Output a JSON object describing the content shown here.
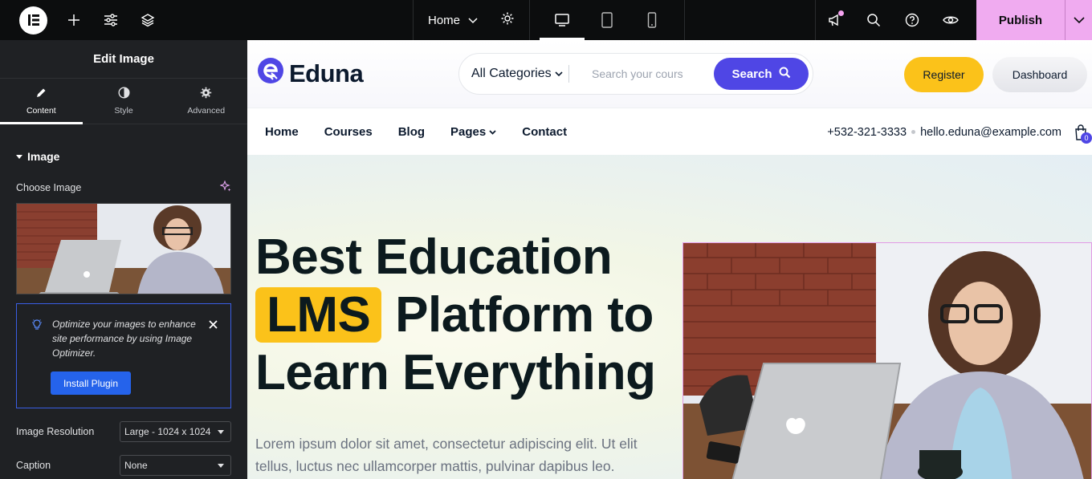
{
  "topbar": {
    "page_name": "Home",
    "publish_label": "Publish"
  },
  "panel": {
    "title": "Edit Image",
    "tabs": [
      {
        "label": "Content",
        "icon": "pencil-icon"
      },
      {
        "label": "Style",
        "icon": "half-circle-icon"
      },
      {
        "label": "Advanced",
        "icon": "gear-icon"
      }
    ],
    "section_title": "Image",
    "choose_image_label": "Choose Image",
    "notice_text": "Optimize your images to enhance site performance by using Image Optimizer.",
    "install_label": "Install Plugin",
    "resolution_label": "Image Resolution",
    "resolution_value": "Large - 1024 x 1024",
    "caption_label": "Caption",
    "caption_value": "None"
  },
  "site": {
    "brand": "Eduna",
    "category_label": "All Categories",
    "search_placeholder": "Search your cours",
    "search_button": "Search",
    "register_label": "Register",
    "dashboard_label": "Dashboard",
    "nav": [
      "Home",
      "Courses",
      "Blog",
      "Pages",
      "Contact"
    ],
    "phone": "+532-321-3333",
    "email": "hello.eduna@example.com",
    "cart_count": "0",
    "hero_line1": "Best Education",
    "hero_highlight": "LMS",
    "hero_line2_rest": "Platform to",
    "hero_line3": "Learn Everything",
    "hero_sub": "Lorem ipsum dolor sit amet, consectetur adipiscing elit. Ut elit tellus, luctus nec ullamcorper mattis, pulvinar dapibus leo.",
    "accent": "#4f46e5",
    "highlight": "#fbc21a"
  }
}
